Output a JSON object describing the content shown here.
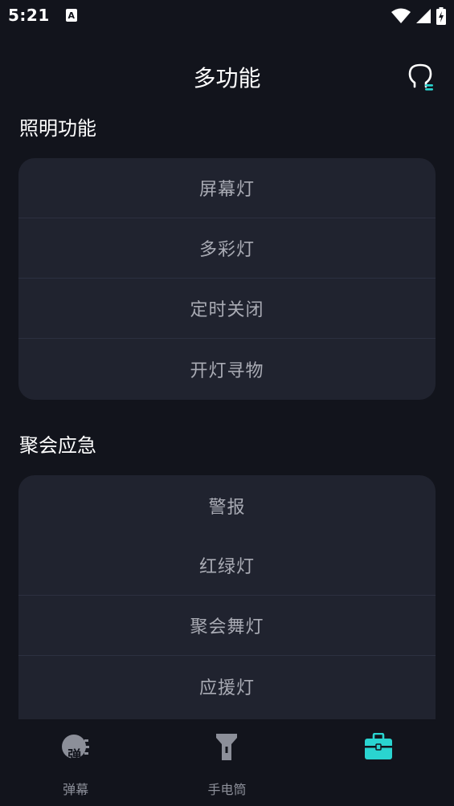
{
  "status": {
    "time": "5:21",
    "notification_glyph": "A"
  },
  "header": {
    "title": "多功能",
    "profile_icon": "profile-icon"
  },
  "sections": [
    {
      "title": "照明功能",
      "items": [
        "屏幕灯",
        "多彩灯",
        "定时关闭",
        "开灯寻物"
      ]
    },
    {
      "title": "聚会应急",
      "items": [
        "警报",
        "红绿灯",
        "聚会舞灯",
        "应援灯"
      ]
    }
  ],
  "nav": {
    "items": [
      {
        "label": "弹幕",
        "icon": "danmu-icon",
        "glyph": "弹"
      },
      {
        "label": "手电筒",
        "icon": "flashlight-icon"
      },
      {
        "label": "",
        "icon": "toolbox-icon"
      }
    ],
    "active_color": "#2ad4d0"
  },
  "colors": {
    "background": "#12141c",
    "card": "#20232f",
    "item_text": "#a9abb4",
    "accent": "#2ad4d0"
  }
}
